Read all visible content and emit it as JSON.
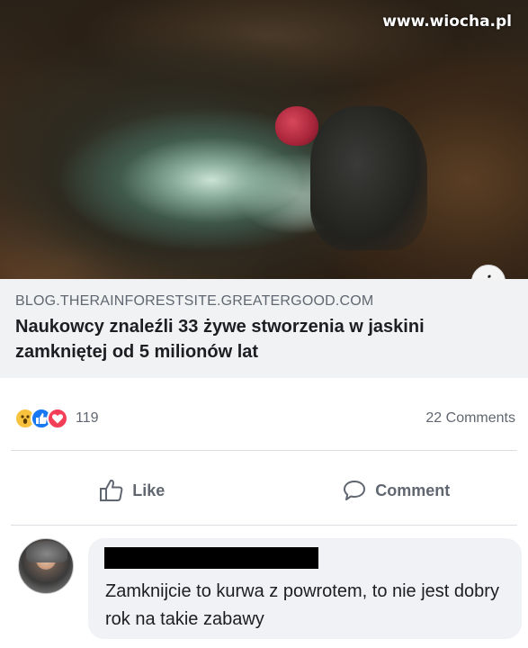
{
  "image": {
    "watermark": "www.wiocha.pl"
  },
  "link": {
    "domain": "BLOG.THERAINFORESTSITE.GREATERGOOD.COM",
    "title": "Naukowcy znaleźli 33 żywe stworzenia w jaskini zamkniętej od 5 milionów lat",
    "info_icon": "i"
  },
  "reactions": {
    "icons": [
      "wow-icon",
      "like-icon",
      "love-icon"
    ],
    "count": "119",
    "comments": "22 Comments"
  },
  "actions": {
    "like_label": "Like",
    "comment_label": "Comment"
  },
  "comment": {
    "text": "Zamknijcie to kurwa z powrotem, to nie jest dobry rok na takie zabawy"
  },
  "colors": {
    "like_blue": "#1877f2",
    "love_red": "#f33e58",
    "wow_yellow": "#f7c33e",
    "meta_gray": "#606770"
  }
}
